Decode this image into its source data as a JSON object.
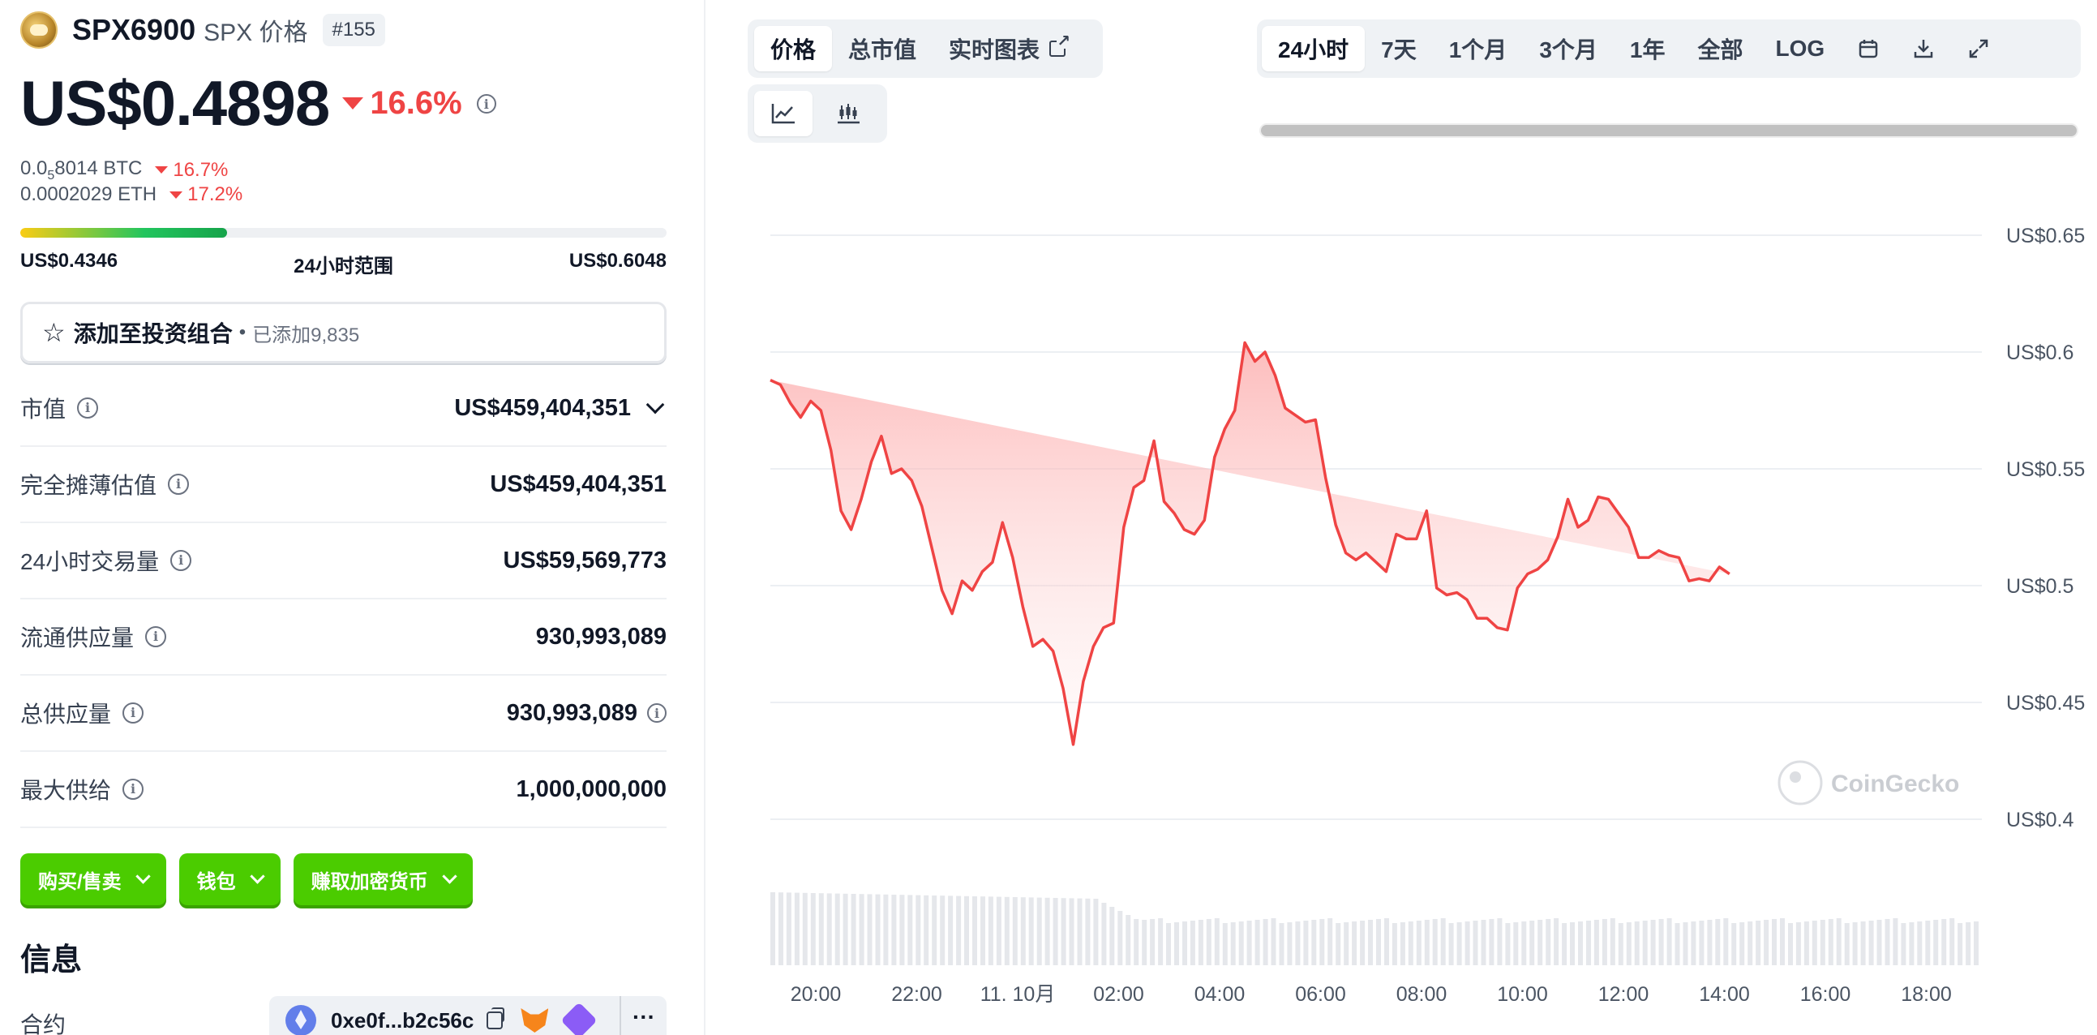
{
  "coin": {
    "name": "SPX6900",
    "symbol_label": "SPX 价格",
    "rank": "#155",
    "price": "US$0.4898",
    "change_pct": "16.6%",
    "btc_price_prefix": "0.0",
    "btc_price_sub": "5",
    "btc_price_suffix": "8014 BTC",
    "btc_change": "16.7%",
    "eth_price": "0.0002029 ETH",
    "eth_change": "17.2%",
    "range_low": "US$0.4346",
    "range_label": "24小时范围",
    "range_high": "US$0.6048",
    "range_position": 0.32
  },
  "portfolio": {
    "label": "添加至投资组合",
    "dot": "•",
    "added": "已添加9,835"
  },
  "stats": [
    {
      "label": "市值",
      "value": "US$459,404,351"
    },
    {
      "label": "完全摊薄估值",
      "value": "US$459,404,351"
    },
    {
      "label": "24小时交易量",
      "value": "US$59,569,773"
    },
    {
      "label": "流通供应量",
      "value": "930,993,089"
    },
    {
      "label": "总供应量",
      "value": "930,993,089"
    },
    {
      "label": "最大供给",
      "value": "1,000,000,000"
    }
  ],
  "actions": {
    "buy_sell": "购买/售卖",
    "wallet": "钱包",
    "earn": "赚取加密货币"
  },
  "info": {
    "heading": "信息",
    "contract_label": "合约",
    "contract_addr": "0xe0f...b2c56c",
    "more": "···"
  },
  "chart_tabs": {
    "price": "价格",
    "market_cap": "总市值",
    "live_chart": "实时图表"
  },
  "range_tabs": {
    "h24": "24小时",
    "d7": "7天",
    "m1": "1个月",
    "m3": "3个月",
    "y1": "1年",
    "all": "全部",
    "log": "LOG"
  },
  "icons": {
    "line_chart": "line-chart-icon",
    "candle_chart": "candlestick-icon",
    "calendar": "calendar-icon",
    "download": "download-icon",
    "expand": "expand-icon"
  },
  "watermark": "CoinGecko",
  "colors": {
    "line": "#ef4444",
    "fill_top": "#fca5a5",
    "accent_green": "#4bcc00"
  },
  "chart_data": {
    "type": "area",
    "ylim": [
      0.4,
      0.65
    ],
    "yticks": [
      {
        "value": 0.65,
        "label": "US$0.65"
      },
      {
        "value": 0.6,
        "label": "US$0.6"
      },
      {
        "value": 0.55,
        "label": "US$0.55"
      },
      {
        "value": 0.5,
        "label": "US$0.5"
      },
      {
        "value": 0.45,
        "label": "US$0.45"
      },
      {
        "value": 0.4,
        "label": "US$0.4"
      }
    ],
    "xlim": [
      19.1,
      43.1
    ],
    "xticks": [
      {
        "value": 20,
        "label": "20:00"
      },
      {
        "value": 22,
        "label": "22:00"
      },
      {
        "value": 24,
        "label": "11. 10月"
      },
      {
        "value": 26,
        "label": "02:00"
      },
      {
        "value": 28,
        "label": "04:00"
      },
      {
        "value": 30,
        "label": "06:00"
      },
      {
        "value": 32,
        "label": "08:00"
      },
      {
        "value": 34,
        "label": "10:00"
      },
      {
        "value": 36,
        "label": "12:00"
      },
      {
        "value": 38,
        "label": "14:00"
      },
      {
        "value": 40,
        "label": "16:00"
      },
      {
        "value": 42,
        "label": "18:00"
      }
    ],
    "x": [
      19.1,
      19.3,
      19.5,
      19.7,
      19.9,
      20.1,
      20.3,
      20.5,
      20.7,
      20.9,
      21.1,
      21.3,
      21.5,
      21.7,
      21.9,
      22.1,
      22.3,
      22.5,
      22.7,
      22.9,
      23.1,
      23.3,
      23.5,
      23.7,
      23.9,
      24.1,
      24.3,
      24.5,
      24.7,
      24.9,
      25.1,
      25.3,
      25.5,
      25.7,
      25.9,
      26.1,
      26.3,
      26.5,
      26.7,
      26.9,
      27.1,
      27.3,
      27.5,
      27.7,
      27.9,
      28.1,
      28.3,
      28.5,
      28.7,
      28.9,
      29.1,
      29.3,
      29.5,
      29.7,
      29.9,
      30.1,
      30.3,
      30.5,
      30.7,
      30.9,
      31.1,
      31.3,
      31.5,
      31.7,
      31.9,
      32.1,
      32.3,
      32.5,
      32.7,
      32.9,
      33.1,
      33.3,
      33.5,
      33.7,
      33.9,
      34.1,
      34.3,
      34.5,
      34.7,
      34.9,
      35.1,
      35.3,
      35.5,
      35.7,
      35.9,
      36.1,
      36.3,
      36.5,
      36.7,
      36.9,
      37.1,
      37.3,
      37.5,
      37.7,
      37.9,
      38.1,
      38.3,
      38.5,
      38.7,
      38.9,
      39.1,
      39.3,
      39.5,
      39.7,
      39.9,
      40.1,
      40.3,
      40.5,
      40.7,
      40.9,
      41.1,
      41.3,
      41.5,
      41.7,
      41.9,
      42.1,
      42.3,
      42.5,
      42.7,
      42.9,
      43.1
    ],
    "y": [
      0.588,
      0.586,
      0.578,
      0.572,
      0.579,
      0.575,
      0.558,
      0.532,
      0.524,
      0.537,
      0.553,
      0.564,
      0.548,
      0.55,
      0.545,
      0.534,
      0.516,
      0.498,
      0.488,
      0.502,
      0.498,
      0.506,
      0.51,
      0.527,
      0.512,
      0.491,
      0.474,
      0.477,
      0.472,
      0.456,
      0.432,
      0.459,
      0.474,
      0.482,
      0.484,
      0.525,
      0.542,
      0.545,
      0.562,
      0.536,
      0.531,
      0.524,
      0.522,
      0.528,
      0.555,
      0.567,
      0.575,
      0.604,
      0.596,
      0.6,
      0.59,
      0.576,
      0.573,
      0.57,
      0.571,
      0.546,
      0.526,
      0.514,
      0.511,
      0.514,
      0.51,
      0.506,
      0.522,
      0.52,
      0.52,
      0.532,
      0.499,
      0.496,
      0.497,
      0.494,
      0.486,
      0.486,
      0.482,
      0.481,
      0.499,
      0.505,
      0.507,
      0.511,
      0.521,
      0.537,
      0.525,
      0.528,
      0.538,
      0.537,
      0.531,
      0.525,
      0.512,
      0.512,
      0.515,
      0.513,
      0.512,
      0.502,
      0.503,
      0.502,
      0.508,
      0.505
    ]
  }
}
